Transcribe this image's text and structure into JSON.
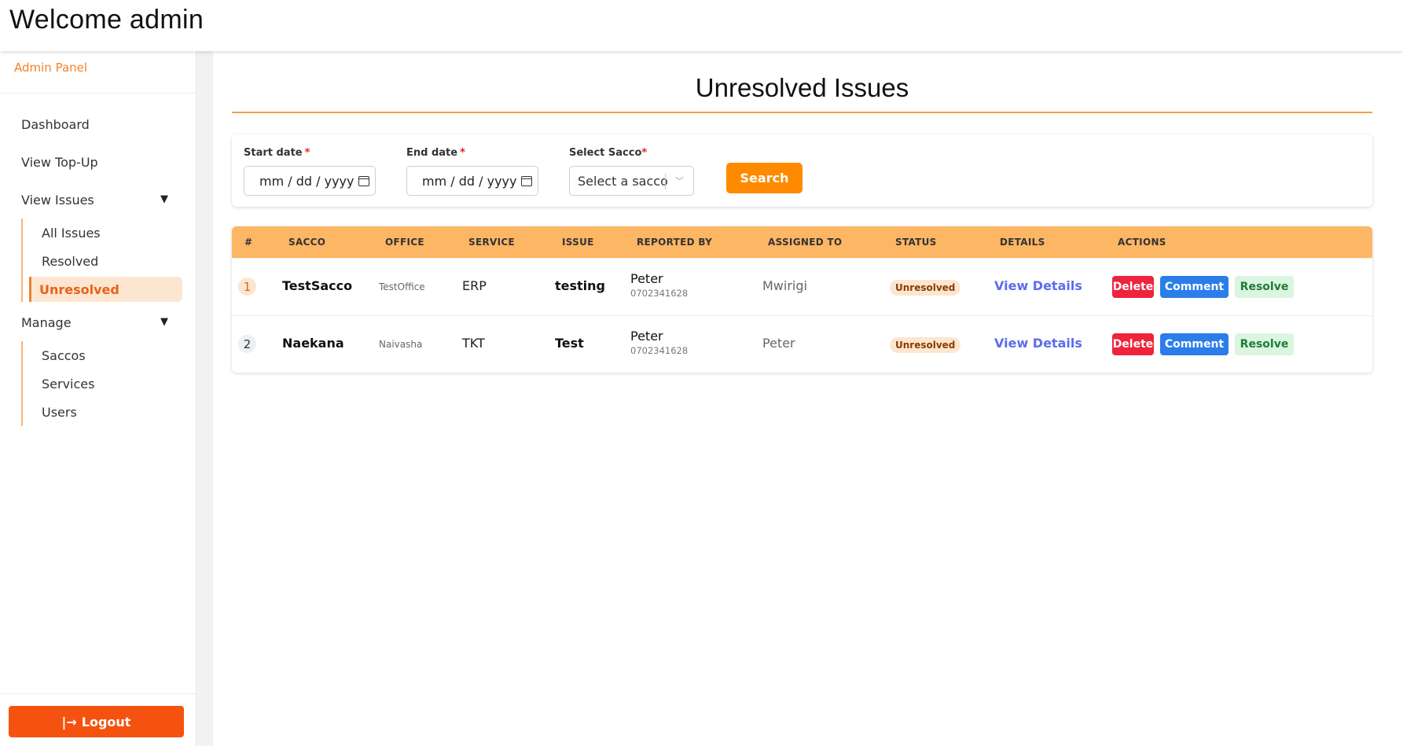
{
  "header": {
    "welcome": "Welcome admin"
  },
  "sidebar": {
    "panel_title": "Admin Panel",
    "items": {
      "dashboard": "Dashboard",
      "view_topup": "View Top-Up",
      "view_issues": "View Issues",
      "all_issues": "All Issues",
      "resolved": "Resolved",
      "unresolved": "Unresolved",
      "manage": "Manage",
      "saccos": "Saccos",
      "services": "Services",
      "users": "Users"
    },
    "caret": "▼",
    "logout": {
      "icon": "|→",
      "label": "Logout"
    }
  },
  "page": {
    "title": "Unresolved Issues"
  },
  "filters": {
    "start_label": "Start date",
    "end_label": "End date",
    "sacco_label": "Select Sacco",
    "required_mark": "*",
    "date_placeholder": "mm / dd / yyyy",
    "sacco_placeholder": "Select a sacco",
    "search_label": "Search"
  },
  "table": {
    "headers": [
      "#",
      "SACCO",
      "OFFICE",
      "SERVICE",
      "ISSUE",
      "REPORTED BY",
      "ASSIGNED TO",
      "STATUS",
      "DETAILS",
      "ACTIONS"
    ],
    "rows": [
      {
        "num": "1",
        "sacco": "TestSacco",
        "office": "TestOffice",
        "service": "ERP",
        "issue": "testing",
        "reporter": "Peter",
        "phone": "0702341628",
        "assigned": "Mwirigi",
        "status": "Unresolved",
        "details": "View Details"
      },
      {
        "num": "2",
        "sacco": "Naekana",
        "office": "Naivasha",
        "service": "TKT",
        "issue": "Test",
        "reporter": "Peter",
        "phone": "0702341628",
        "assigned": "Peter",
        "status": "Unresolved",
        "details": "View Details"
      }
    ],
    "actions": {
      "delete": "Delete",
      "comment": "Comment",
      "resolve": "Resolve"
    }
  },
  "colors": {
    "accent": "#ff8a00",
    "header_row": "#fdb664",
    "logout": "#f5520f",
    "delete": "#ef233c",
    "comment": "#2b7de9",
    "resolve_bg": "#daf5e0",
    "link": "#5b6cf0"
  }
}
